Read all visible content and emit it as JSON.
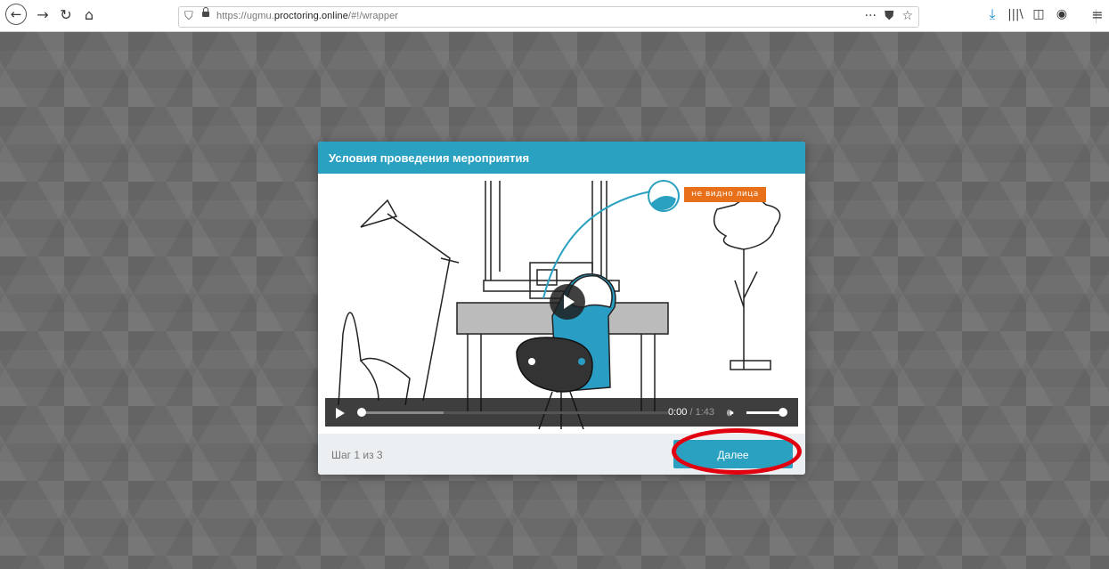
{
  "browser": {
    "url_prefix": "https://ugmu.",
    "url_domain": "proctoring.online",
    "url_suffix": "/#!/wrapper",
    "icons": [
      "back-icon",
      "forward-icon",
      "reload-icon",
      "home-icon",
      "shield-icon",
      "lock-icon",
      "more-icon",
      "pocket-icon",
      "bookmark-star-icon",
      "download-icon",
      "library-icon",
      "sidebar-icon",
      "account-icon",
      "menu-icon"
    ]
  },
  "modal": {
    "title": "Условия проведения мероприятия",
    "video": {
      "badge_text": "не видно лица",
      "current_time": "0:00",
      "separator": " / ",
      "duration": "1:43",
      "progress_fraction": 0,
      "buffered_fraction": 0.27,
      "volume_fraction": 1.0
    },
    "footer": {
      "step_text": "Шаг 1 из 3",
      "next_label": "Далее"
    }
  },
  "colors": {
    "accent": "#2aa1c0",
    "highlight": "#e0000f",
    "badge": "#e8701a"
  }
}
